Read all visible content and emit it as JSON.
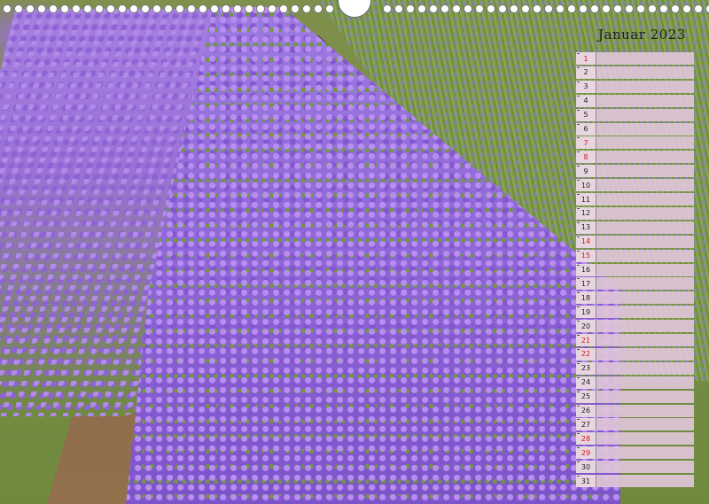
{
  "calendar": {
    "title": "Januar 2023",
    "days": [
      {
        "n": "1",
        "red": true
      },
      {
        "n": "2",
        "red": false
      },
      {
        "n": "3",
        "red": false
      },
      {
        "n": "4",
        "red": false
      },
      {
        "n": "5",
        "red": false
      },
      {
        "n": "6",
        "red": false
      },
      {
        "n": "7",
        "red": true
      },
      {
        "n": "8",
        "red": true
      },
      {
        "n": "9",
        "red": false
      },
      {
        "n": "10",
        "red": false
      },
      {
        "n": "11",
        "red": false
      },
      {
        "n": "12",
        "red": false
      },
      {
        "n": "13",
        "red": false
      },
      {
        "n": "14",
        "red": true
      },
      {
        "n": "15",
        "red": true
      },
      {
        "n": "16",
        "red": false
      },
      {
        "n": "17",
        "red": false
      },
      {
        "n": "18",
        "red": false
      },
      {
        "n": "19",
        "red": false
      },
      {
        "n": "20",
        "red": false
      },
      {
        "n": "21",
        "red": true
      },
      {
        "n": "22",
        "red": true
      },
      {
        "n": "23",
        "red": false
      },
      {
        "n": "24",
        "red": false
      },
      {
        "n": "25",
        "red": false
      },
      {
        "n": "26",
        "red": false
      },
      {
        "n": "27",
        "red": false
      },
      {
        "n": "28",
        "red": true
      },
      {
        "n": "29",
        "red": true
      },
      {
        "n": "30",
        "red": false
      },
      {
        "n": "31",
        "red": false
      }
    ]
  },
  "colors": {
    "weekend": "#d41a1a",
    "cell": "#e7d5e0"
  }
}
